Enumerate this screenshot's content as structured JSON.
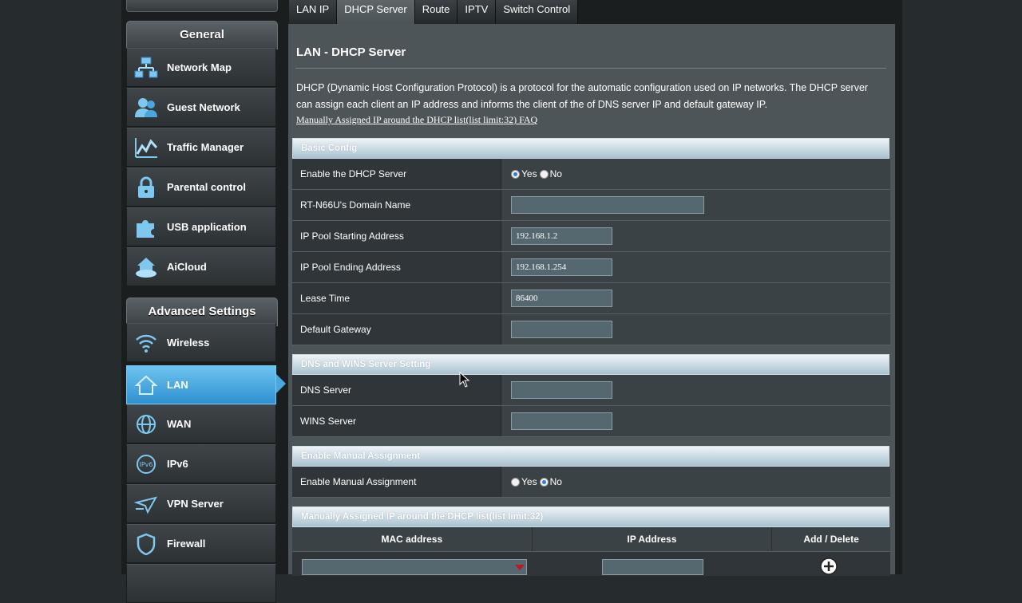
{
  "sidebar": {
    "general_header": "General",
    "general_items": [
      {
        "label": "Network Map",
        "icon": "network-map-icon"
      },
      {
        "label": "Guest Network",
        "icon": "guest-network-icon"
      },
      {
        "label": "Traffic Manager",
        "icon": "traffic-manager-icon"
      },
      {
        "label": "Parental control",
        "icon": "parental-control-icon"
      },
      {
        "label": "USB application",
        "icon": "usb-application-icon"
      },
      {
        "label": "AiCloud",
        "icon": "aicloud-icon"
      }
    ],
    "advanced_header": "Advanced Settings",
    "advanced_items": [
      {
        "label": "Wireless",
        "icon": "wireless-icon"
      },
      {
        "label": "LAN",
        "icon": "lan-home-icon",
        "active": true
      },
      {
        "label": "WAN",
        "icon": "wan-globe-icon"
      },
      {
        "label": "IPv6",
        "icon": "ipv6-icon"
      },
      {
        "label": "VPN Server",
        "icon": "vpn-server-icon"
      },
      {
        "label": "Firewall",
        "icon": "firewall-shield-icon"
      }
    ]
  },
  "tabs": [
    "LAN IP",
    "DHCP Server",
    "Route",
    "IPTV",
    "Switch Control"
  ],
  "active_tab": "DHCP Server",
  "page": {
    "title": "LAN - DHCP Server",
    "description": "DHCP (Dynamic Host Configuration Protocol) is a protocol for the automatic configuration used on IP networks. The DHCP server can assign each client an IP address and informs the client of the of DNS server IP and default gateway IP.",
    "faq_link": "Manually Assigned IP around the DHCP list(list limit:32) FAQ"
  },
  "basic_config": {
    "header": "Basic Config",
    "enable_dhcp": {
      "label": "Enable the DHCP Server",
      "yes": "Yes",
      "no": "No",
      "selected": "Yes"
    },
    "domain_name": {
      "label": "RT-N66U's Domain Name",
      "value": ""
    },
    "pool_start": {
      "label": "IP Pool Starting Address",
      "value": "192.168.1.2"
    },
    "pool_end": {
      "label": "IP Pool Ending Address",
      "value": "192.168.1.254"
    },
    "lease_time": {
      "label": "Lease Time",
      "value": "86400"
    },
    "default_gateway": {
      "label": "Default Gateway",
      "value": ""
    }
  },
  "dns_wins": {
    "header": "DNS and WINS Server Setting",
    "dns_server": {
      "label": "DNS Server",
      "value": ""
    },
    "wins_server": {
      "label": "WINS Server",
      "value": ""
    }
  },
  "manual_assignment": {
    "header": "Enable Manual Assignment",
    "enable": {
      "label": "Enable Manual Assignment",
      "yes": "Yes",
      "no": "No",
      "selected": "No"
    }
  },
  "manual_list": {
    "header": "Manually Assigned IP around the DHCP list(list limit:32)",
    "columns": [
      "MAC address",
      "IP Address",
      "Add / Delete"
    ]
  },
  "colors": {
    "active_nav": "#3a9ee0",
    "panel_bg": "#4d5558",
    "section_header": "#d6e4eb"
  }
}
